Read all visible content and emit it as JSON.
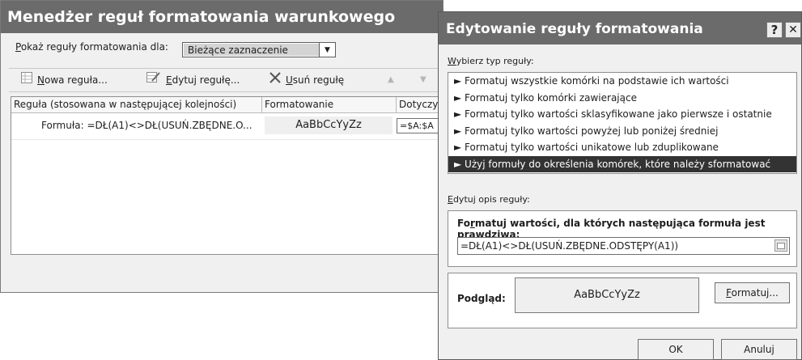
{
  "manager": {
    "title": "Menedżer reguł formatowania warunkowego",
    "show_rules_for": {
      "label_first": "P",
      "label_rest": "okaż reguły formatowania dla:"
    },
    "scope_value": "Bieżące zaznaczenie",
    "toolbar": {
      "new_rule": {
        "first": "N",
        "rest": "owa reguła..."
      },
      "edit_rule": {
        "first": "E",
        "rest": "dytuj regułę..."
      },
      "delete_rule": {
        "first": "U",
        "rest": "suń regułę"
      },
      "move_up": "▲",
      "move_down": "▼"
    },
    "table": {
      "columns": [
        "Reguła (stosowana w następującej kolejności)",
        "Formatowanie",
        "Dotyczy"
      ],
      "rows": [
        {
          "rule": "Formuła: =DŁ(A1)<>DŁ(USUŃ.ZBĘDNE.O...",
          "format_preview": "AaBbCcYyZz",
          "applies_to": "=$A:$A"
        }
      ]
    }
  },
  "editor": {
    "title": "Edytowanie reguły formatowania",
    "help": "?",
    "close": "✕",
    "select_type_label": {
      "first": "W",
      "rest": "ybierz typ reguły:"
    },
    "rule_types": [
      "► Formatuj wszystkie komórki na podstawie ich wartości",
      "► Formatuj tylko komórki zawierające",
      "► Formatuj tylko wartości sklasyfikowane jako pierwsze i ostatnie",
      "► Formatuj tylko wartości powyżej lub poniżej średniej",
      "► Formatuj tylko wartości unikatowe lub zduplikowane",
      "► Użyj formuły do określenia komórek, które należy sformatować"
    ],
    "selected_rule_type_index": 5,
    "edit_desc_label": {
      "first": "E",
      "rest": "dytuj opis reguły:"
    },
    "formula_label": {
      "pre": "Fo",
      "u": "r",
      "post": "matuj wartości, dla których następująca formuła jest prawdziwa:"
    },
    "formula_value": "=DŁ(A1)<>DŁ(USUŃ.ZBĘDNE.ODSTĘPY(A1))",
    "preview_label": "Podgląd:",
    "preview_text": "AaBbCcYyZz",
    "format_button": {
      "first": "F",
      "rest": "ormatuj..."
    },
    "ok": "OK",
    "cancel": "Anuluj"
  }
}
